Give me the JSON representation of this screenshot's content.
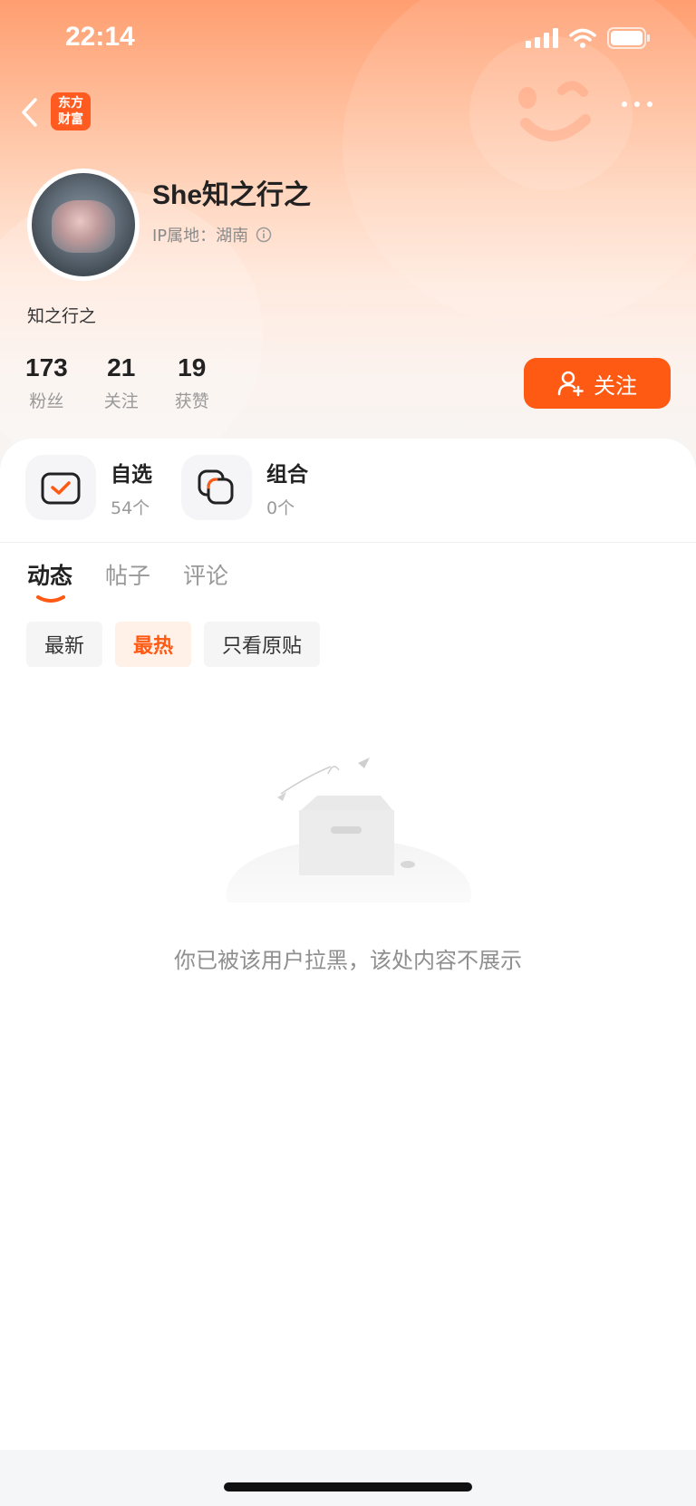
{
  "status_bar": {
    "time": "22:14"
  },
  "header": {
    "logo_line1": "东方",
    "logo_line2": "财富"
  },
  "profile": {
    "name": "She知之行之",
    "ip_label": "IP属地：湖南",
    "bio": "知之行之"
  },
  "stats": [
    {
      "value": "173",
      "label": "粉丝"
    },
    {
      "value": "21",
      "label": "关注"
    },
    {
      "value": "19",
      "label": "获赞"
    }
  ],
  "follow_button": {
    "label": "关注"
  },
  "quick_links": [
    {
      "title": "自选",
      "sub": "54个"
    },
    {
      "title": "组合",
      "sub": "0个"
    }
  ],
  "tabs": [
    "动态",
    "帖子",
    "评论"
  ],
  "filters": [
    "最新",
    "最热",
    "只看原贴"
  ],
  "empty_message": "你已被该用户拉黑，该处内容不展示",
  "colors": {
    "accent": "#ff5a14"
  }
}
